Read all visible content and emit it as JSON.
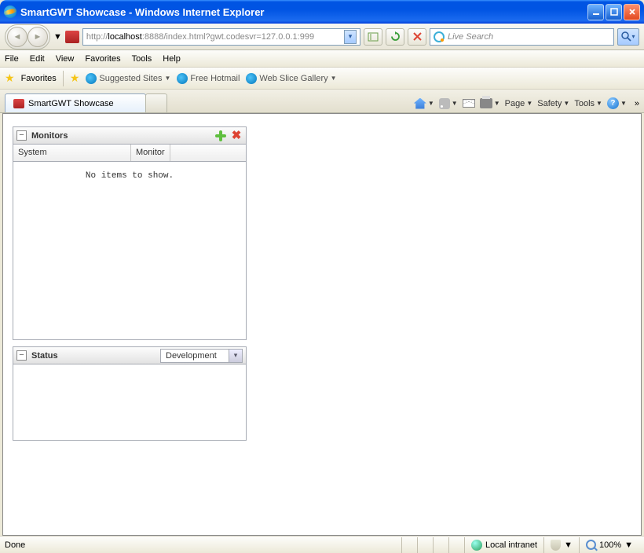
{
  "window": {
    "title": "SmartGWT Showcase - Windows Internet Explorer"
  },
  "nav": {
    "url_prefix": "http://",
    "url_host": "localhost",
    "url_rest": ":8888/index.html?gwt.codesvr=127.0.0.1:999",
    "search_placeholder": "Live Search"
  },
  "menu": {
    "file": "File",
    "edit": "Edit",
    "view": "View",
    "favorites": "Favorites",
    "tools": "Tools",
    "help": "Help"
  },
  "favbar": {
    "favorites": "Favorites",
    "suggested": "Suggested Sites",
    "hotmail": "Free Hotmail",
    "webslice": "Web Slice Gallery"
  },
  "tab": {
    "label": "SmartGWT Showcase"
  },
  "cmd": {
    "page": "Page",
    "safety": "Safety",
    "tools": "Tools"
  },
  "monitors": {
    "title": "Monitors",
    "col_system": "System",
    "col_monitor": "Monitor",
    "empty": "No items to show."
  },
  "status_panel": {
    "title": "Status",
    "selected": "Development"
  },
  "statusbar": {
    "done": "Done",
    "zone": "Local intranet",
    "zoom": "100%"
  }
}
